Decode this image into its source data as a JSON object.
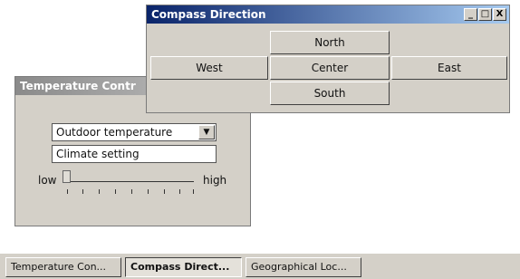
{
  "windows": {
    "temperature": {
      "title": "Temperature Contr",
      "combo_value": "Outdoor temperature",
      "text_value": "Climate setting",
      "slider_low": "low",
      "slider_high": "high",
      "slider_value": 0
    },
    "compass": {
      "title": "Compass Direction",
      "buttons": {
        "north": "North",
        "west": "West",
        "center": "Center",
        "east": "East",
        "south": "South"
      },
      "controls": {
        "minimize": "_",
        "maximize": "□",
        "close": "X"
      }
    }
  },
  "taskbar": {
    "items": [
      {
        "label": "Temperature Con...",
        "active": false
      },
      {
        "label": "Compass Direct...",
        "active": true
      },
      {
        "label": "Geographical Loc...",
        "active": false
      }
    ]
  }
}
